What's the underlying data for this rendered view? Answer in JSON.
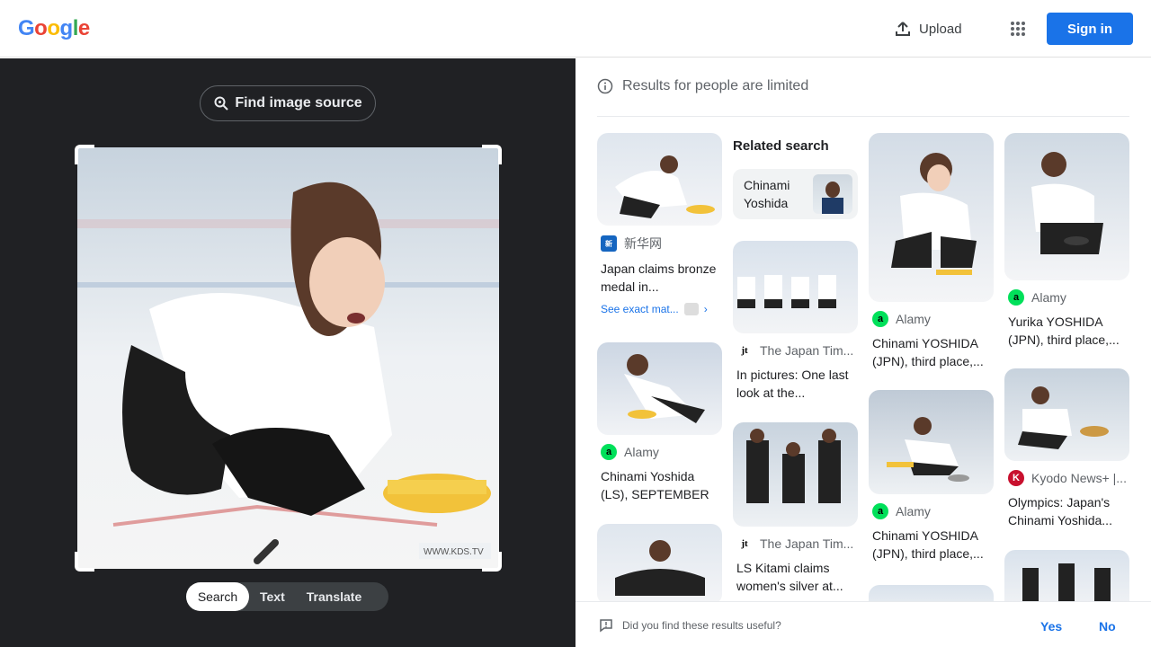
{
  "header": {
    "logo_text": "Google",
    "upload_label": "Upload",
    "signin_label": "Sign in"
  },
  "left": {
    "find_source_label": "Find image source",
    "tabs": [
      "Search",
      "Text",
      "Translate"
    ],
    "active_tab": "Search",
    "watermark": "WWW.KDS.TV"
  },
  "right": {
    "limited_notice": "Results for people are limited",
    "related_heading": "Related search",
    "related_chip_label": "Chinami Yoshida",
    "results": [
      {
        "source": "新华网",
        "title": "Japan claims bronze medal in...",
        "exact": "See exact mat..."
      },
      {
        "source": "The Japan Tim...",
        "title": "In pictures: One last look at the..."
      },
      {
        "source": "Alamy",
        "title": "Chinami YOSHIDA (JPN), third place,..."
      },
      {
        "source": "Alamy",
        "title": "Yurika YOSHIDA (JPN), third place,..."
      },
      {
        "source": "Alamy",
        "title": "Chinami Yoshida (LS), SEPTEMBER ..."
      },
      {
        "source": "The Japan Tim...",
        "title": "LS Kitami claims women's silver at..."
      },
      {
        "source": "Alamy",
        "title": "Chinami YOSHIDA (JPN), third place,..."
      },
      {
        "source": "Kyodo News+ |...",
        "title": "Olympics: Japan's Chinami Yoshida..."
      }
    ]
  },
  "feedback": {
    "question": "Did you find these results useful?",
    "yes": "Yes",
    "no": "No"
  },
  "colors": {
    "accent": "#1a73e8",
    "dark_bg": "#202124",
    "alamy_green": "#00e05a",
    "kyodo_red": "#c8102e"
  }
}
